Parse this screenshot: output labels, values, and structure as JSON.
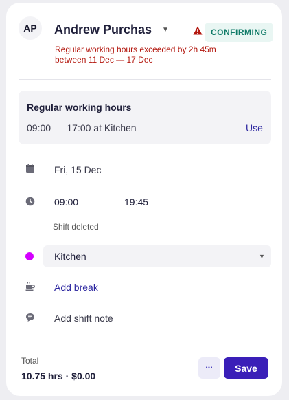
{
  "header": {
    "avatar_initials": "AP",
    "employee_name": "Andrew Purchas",
    "status_badge": "CONFIRMING",
    "warning_line1": "Regular working hours exceeded by 2h 45m",
    "warning_line2": "between 11 Dec — 17 Dec"
  },
  "regular_hours": {
    "title": "Regular working hours",
    "value": "09:00  –  17:00 at Kitchen",
    "use_label": "Use"
  },
  "shift": {
    "date": "Fri, 15 Dec",
    "start_time": "09:00",
    "separator": "—",
    "end_time": "19:45",
    "shift_deleted_note": "Shift deleted",
    "position": "Kitchen",
    "add_break_label": "Add break",
    "add_note_placeholder": "Add shift note"
  },
  "footer": {
    "total_label": "Total",
    "total_value": "10.75 hrs · $0.00",
    "more_label": "•••",
    "save_label": "Save"
  },
  "icons": {
    "calendar": "calendar-icon",
    "clock": "clock-icon",
    "coffee": "coffee-icon",
    "note": "comment-icon",
    "warning": "warning-icon"
  },
  "colors": {
    "accent": "#3a1fb8",
    "position_dot": "#d400ff",
    "warning": "#b3160d",
    "badge_text": "#0e7a67"
  }
}
